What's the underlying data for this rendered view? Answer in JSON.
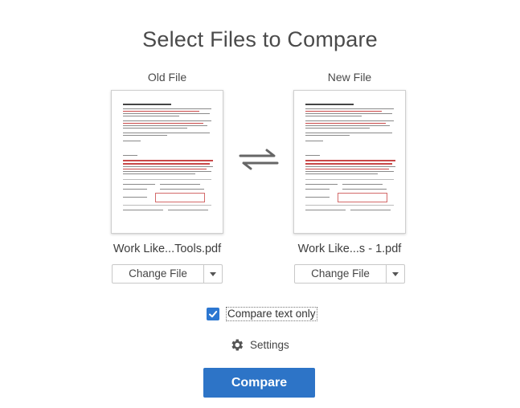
{
  "dialog": {
    "title": "Select Files to Compare"
  },
  "old_file": {
    "label": "Old File",
    "filename": "Work Like...Tools.pdf",
    "change_label": "Change File"
  },
  "new_file": {
    "label": "New File",
    "filename": "Work Like...s - 1.pdf",
    "change_label": "Change File"
  },
  "options": {
    "compare_text_only_label": "Compare text only",
    "compare_text_only_checked": true,
    "settings_label": "Settings"
  },
  "actions": {
    "compare_label": "Compare"
  },
  "colors": {
    "accent": "#2d74c7",
    "checkbox": "#2c77d1"
  },
  "icons": {
    "swap": "swap-arrows-icon",
    "settings": "gear-icon",
    "dropdown": "chevron-down-icon",
    "check": "checkmark-icon"
  }
}
